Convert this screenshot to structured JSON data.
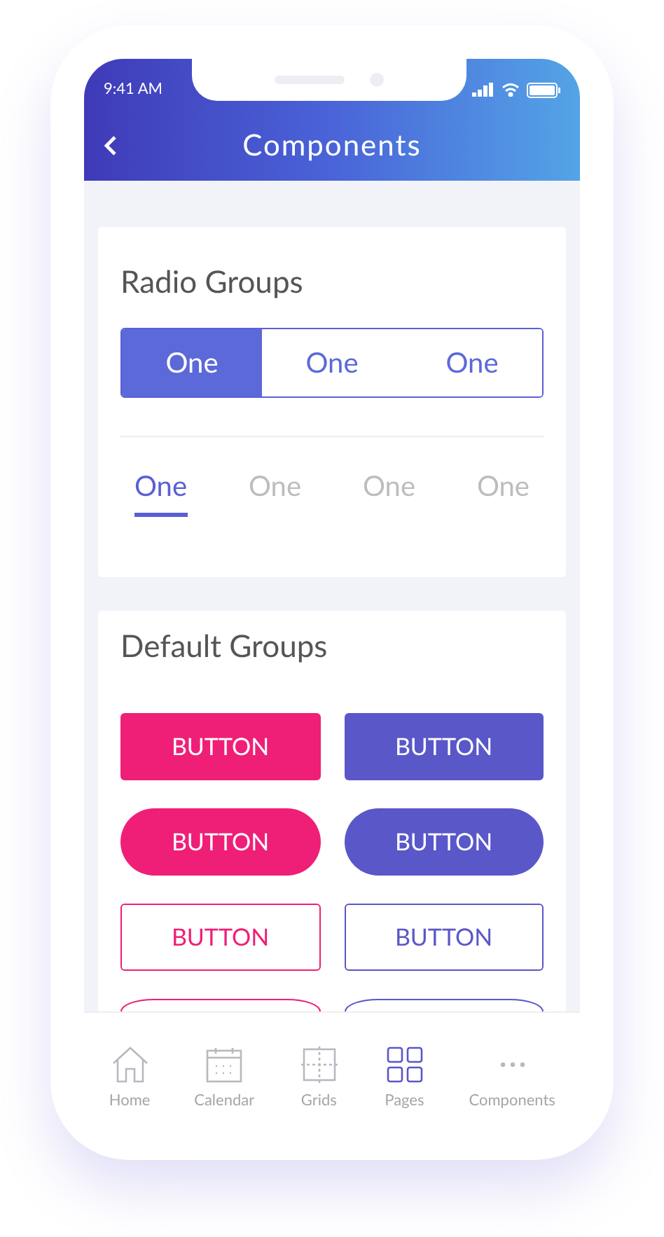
{
  "status_bar": {
    "time": "9:41 AM"
  },
  "header": {
    "title": "Components"
  },
  "radio_card": {
    "title": "Radio Groups",
    "segmented": [
      {
        "label": "One",
        "selected": true
      },
      {
        "label": "One",
        "selected": false
      },
      {
        "label": "One",
        "selected": false
      }
    ],
    "underline_tabs": [
      {
        "label": "One",
        "selected": true
      },
      {
        "label": "One",
        "selected": false
      },
      {
        "label": "One",
        "selected": false
      },
      {
        "label": "One",
        "selected": false
      }
    ]
  },
  "default_card": {
    "title": "Default Groups",
    "buttons": [
      {
        "label": "BUTTON",
        "kind": "filled-square",
        "color": "#ef1f77"
      },
      {
        "label": "BUTTON",
        "kind": "filled-square",
        "color": "#5a57c9"
      },
      {
        "label": "BUTTON",
        "kind": "filled-pill",
        "color": "#ef1f77"
      },
      {
        "label": "BUTTON",
        "kind": "filled-pill",
        "color": "#5a57c9"
      },
      {
        "label": "BUTTON",
        "kind": "outline-square",
        "color": "#ef1f77"
      },
      {
        "label": "BUTTON",
        "kind": "outline-square",
        "color": "#5a57c9"
      },
      {
        "kind": "outline-pill",
        "color": "#ef1f77"
      },
      {
        "kind": "outline-pill",
        "color": "#5a57c9"
      }
    ]
  },
  "tab_bar": [
    {
      "label": "Home",
      "kind": "home",
      "selected": false
    },
    {
      "label": "Calendar",
      "kind": "calendar",
      "selected": false
    },
    {
      "label": "Grids",
      "kind": "grid",
      "selected": false
    },
    {
      "label": "Pages",
      "kind": "pages",
      "selected": true
    },
    {
      "label": "Components",
      "kind": "more",
      "selected": false
    }
  ]
}
